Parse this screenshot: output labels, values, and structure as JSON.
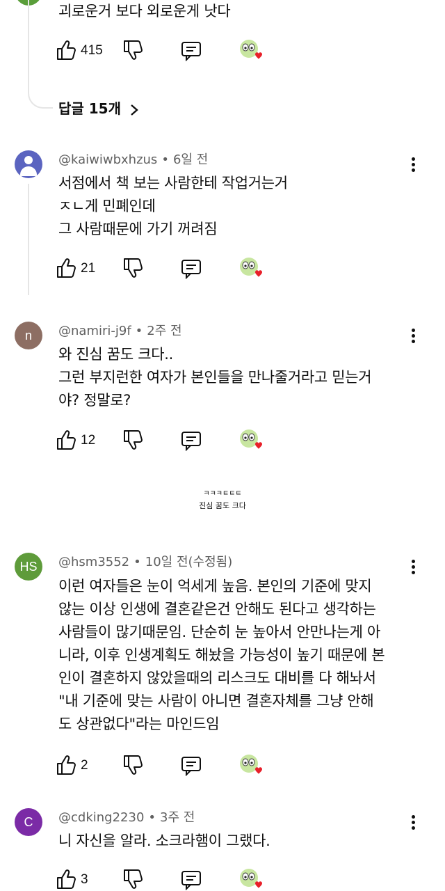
{
  "top_comment": {
    "text": "괴로운거 보다 외로운게 낫다",
    "likes": "415",
    "replies_label": "답글 15개"
  },
  "comments": [
    {
      "author": "@kaiwiwbxhzus",
      "time": "6일 전",
      "text": "서점에서 책 보는 사람한테 작업거는거\nㅈㄴ게 민폐인데\n그 사람때문에 가기 꺼려짐",
      "likes": "21"
    },
    {
      "author": "@namiri-j9f",
      "time": "2주 전",
      "avatar_letter": "n",
      "avatar_color": "#8d6e63",
      "text": "와 진심 꿈도 크다..\n그런 부지런한 여자가 본인들을 만나줄거라고 믿는거\n야? 정말로?",
      "likes": "12"
    },
    {
      "author": "@hsm3552",
      "time": "10일 전(수정됨)",
      "avatar_letter": "HS",
      "avatar_color": "#5e9b3a",
      "text": "이런 여자들은 눈이 억세게 높음. 본인의 기준에 맞지\n않는 이상 인생에 결혼같은건 안해도 된다고 생각하는\n사람들이 많기때문임. 단순히 눈 높아서 안만나는게 아\n니라, 이후 인생계획도 해놨을 가능성이 높기 때문에 본\n인이 결혼하지 않았을때의 리스크도 대비를 다 해놔서\n\"내 기준에 맞는 사람이 아니면 결혼자체를 그냥 안해\n도 상관없다\"라는 마인드임",
      "likes": "2"
    },
    {
      "author": "@cdking2230",
      "time": "3주 전",
      "avatar_letter": "C",
      "avatar_color": "#7b2ba6",
      "text": "니 자신을 알라. 소크라햄이 그랬다.",
      "likes": "3"
    }
  ],
  "memo": {
    "line1": "ㅋㅋㅋㅌㅌㅌ",
    "line2": "진심 꿈도 크다"
  },
  "icons": {
    "like": "thumbs-up-icon",
    "dislike": "thumbs-down-icon",
    "reply": "reply-icon",
    "emoji": "emoji-heart-icon",
    "menu": "more-vert-icon"
  }
}
